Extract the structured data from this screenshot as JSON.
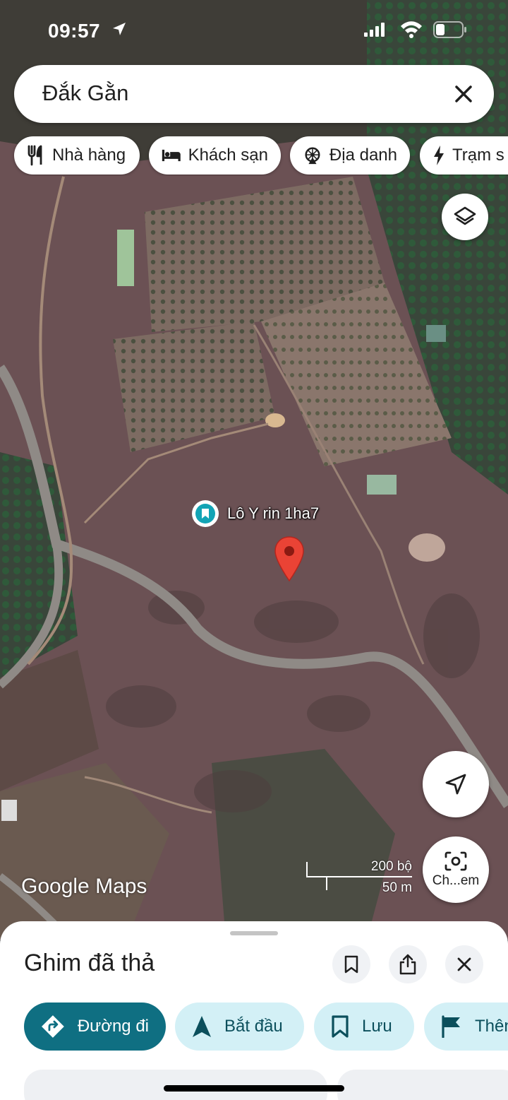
{
  "status_bar": {
    "time": "09:57"
  },
  "search": {
    "query": "Đắk Gằn"
  },
  "chips": [
    {
      "label": "Nhà hàng",
      "icon": "restaurant-icon"
    },
    {
      "label": "Khách sạn",
      "icon": "hotel-icon"
    },
    {
      "label": "Địa danh",
      "icon": "landmark-icon"
    },
    {
      "label": "Trạm s",
      "icon": "ev-charging-icon"
    }
  ],
  "map": {
    "poi_label": "Lô Y rin 1ha7",
    "brand": "Google Maps",
    "scale": {
      "imperial": "200 bộ",
      "metric": "50 m"
    },
    "lens_label": "Ch...em"
  },
  "sheet": {
    "title": "Ghim đã thả",
    "actions": [
      {
        "label": "Đường đi",
        "icon": "directions-icon"
      },
      {
        "label": "Bắt đầu",
        "icon": "navigation-arrow-icon"
      },
      {
        "label": "Lưu",
        "icon": "bookmark-icon"
      },
      {
        "label": "Thên",
        "icon": "flag-icon"
      }
    ]
  },
  "colors": {
    "primary_action": "#0f6f82",
    "secondary_action": "#d3f0f6",
    "poi_teal": "#12a4b5",
    "pin_red": "#ea4335"
  }
}
